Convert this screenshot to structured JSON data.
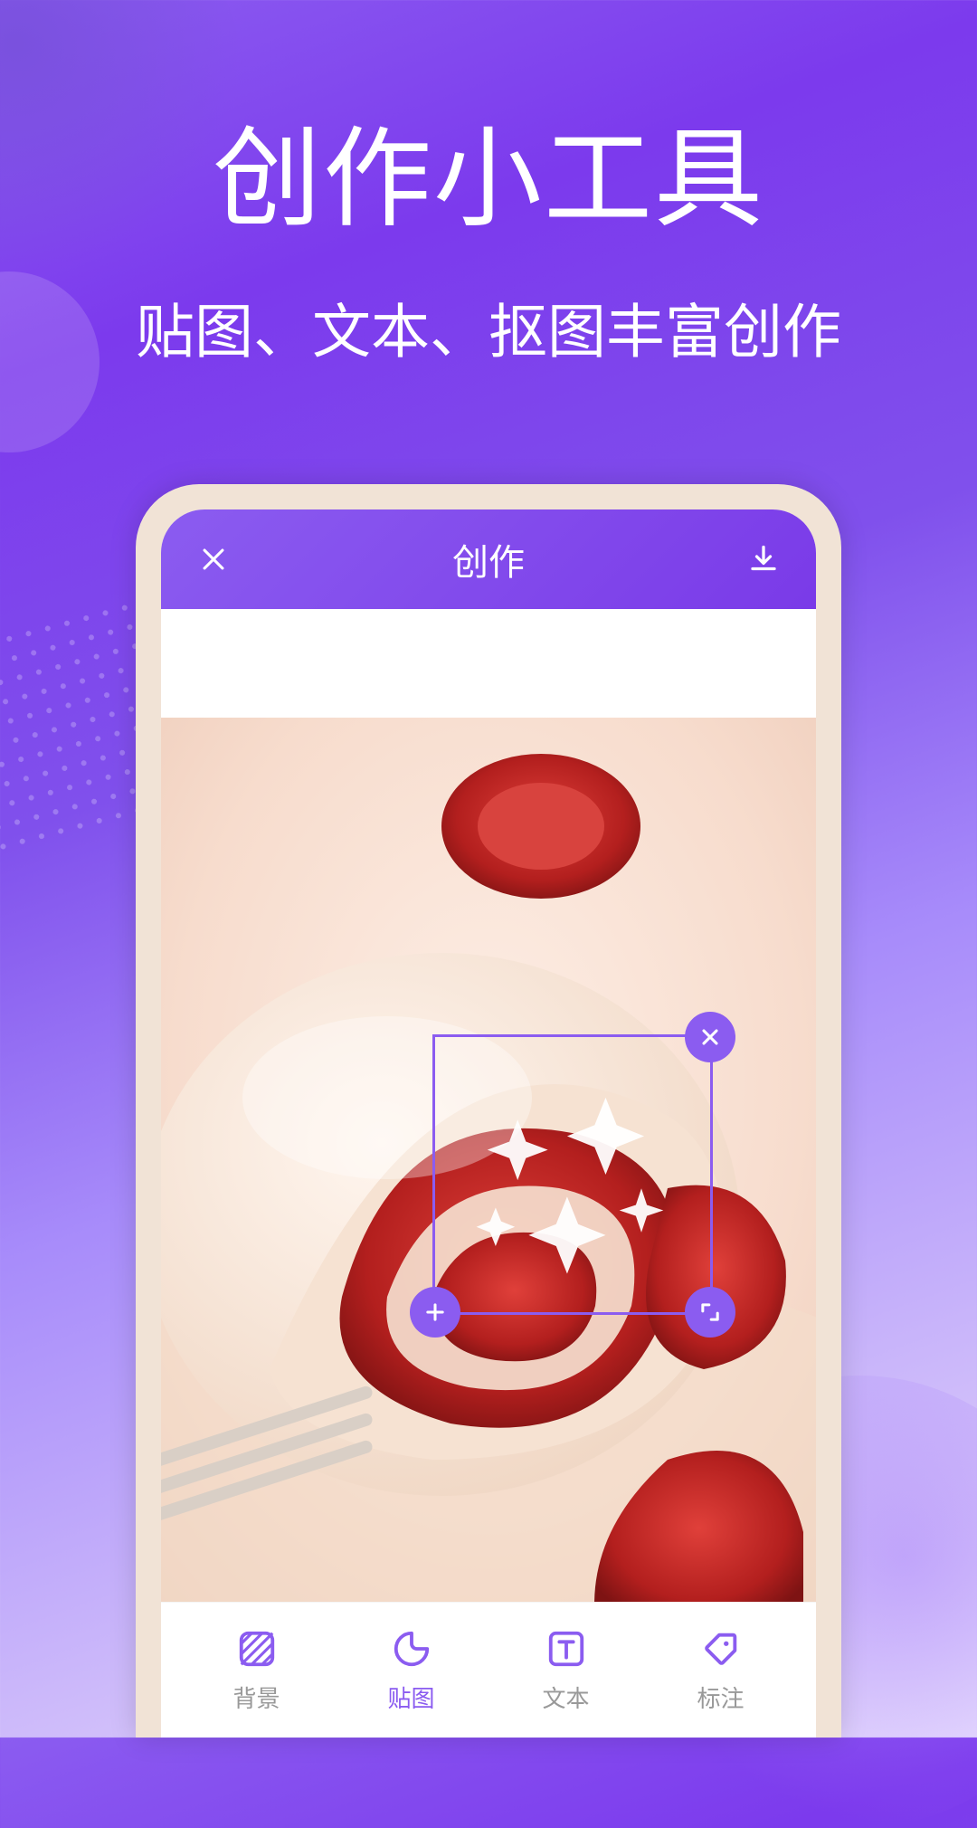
{
  "marketing": {
    "title": "创作小工具",
    "subtitle": "贴图、文本、抠图丰富创作"
  },
  "app": {
    "header": {
      "title": "创作"
    },
    "icons": {
      "close": "close-icon",
      "download": "download-icon",
      "selection_delete": "close-icon",
      "selection_add": "plus-icon",
      "selection_resize": "resize-icon"
    },
    "tools": [
      {
        "id": "background",
        "label": "背景",
        "icon": "pattern-icon",
        "active": false
      },
      {
        "id": "sticker",
        "label": "贴图",
        "icon": "sticker-icon",
        "active": true
      },
      {
        "id": "text",
        "label": "文本",
        "icon": "text-icon",
        "active": false
      },
      {
        "id": "annotate",
        "label": "标注",
        "icon": "tag-icon",
        "active": false
      }
    ]
  },
  "colors": {
    "accent": "#8b5cf0",
    "inactive": "#999999"
  }
}
